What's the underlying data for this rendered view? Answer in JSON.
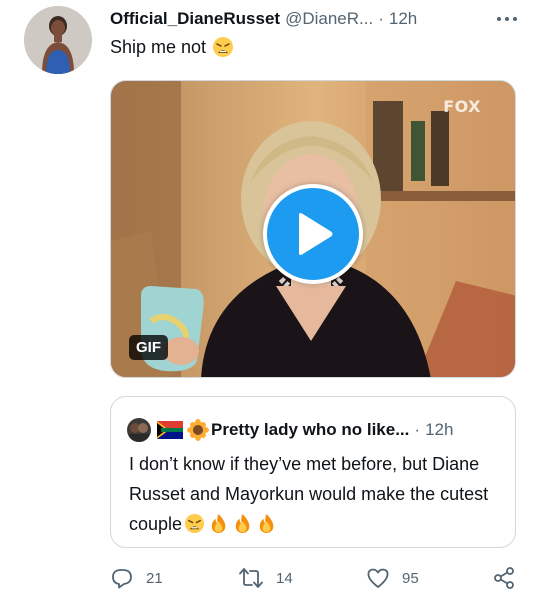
{
  "tweet": {
    "display_name": "Official_DianeRusset",
    "handle": "@DianeR...",
    "separator": "·",
    "time": "12h",
    "text": "Ship me not",
    "media": {
      "watermark": "FOX",
      "badge": "GIF"
    }
  },
  "quote": {
    "display_name": "Pretty lady who no like...",
    "separator": "·",
    "time": "12h",
    "text": "I don’t know if they’ve met before, but Diane Russet and Mayorkun would make the cutest couple"
  },
  "actions": {
    "replies": "21",
    "retweets": "14",
    "likes": "95"
  },
  "icons": {
    "text_emoji": "tired-face-icon",
    "quote_emojis": [
      "tired-face-icon",
      "fire-icon",
      "fire-icon",
      "fire-icon"
    ],
    "flag": "south-africa-flag-icon",
    "sunflower": "sunflower-icon"
  },
  "colors": {
    "accent": "#1d9bf0",
    "text": "#0f1419",
    "muted": "#536471",
    "border": "#cfd9de"
  }
}
